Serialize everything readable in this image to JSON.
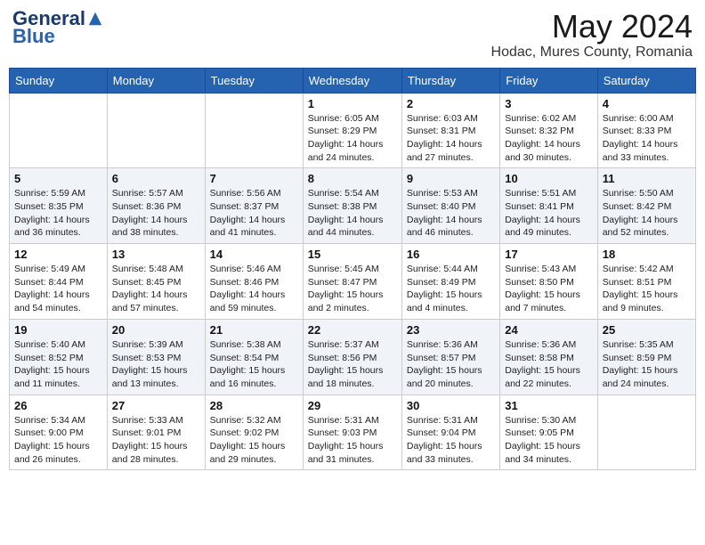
{
  "logo": {
    "general": "General",
    "blue": "Blue"
  },
  "header": {
    "month_year": "May 2024",
    "location": "Hodac, Mures County, Romania"
  },
  "days_of_week": [
    "Sunday",
    "Monday",
    "Tuesday",
    "Wednesday",
    "Thursday",
    "Friday",
    "Saturday"
  ],
  "weeks": [
    [
      {
        "day": "",
        "info": ""
      },
      {
        "day": "",
        "info": ""
      },
      {
        "day": "",
        "info": ""
      },
      {
        "day": "1",
        "info": "Sunrise: 6:05 AM\nSunset: 8:29 PM\nDaylight: 14 hours and 24 minutes."
      },
      {
        "day": "2",
        "info": "Sunrise: 6:03 AM\nSunset: 8:31 PM\nDaylight: 14 hours and 27 minutes."
      },
      {
        "day": "3",
        "info": "Sunrise: 6:02 AM\nSunset: 8:32 PM\nDaylight: 14 hours and 30 minutes."
      },
      {
        "day": "4",
        "info": "Sunrise: 6:00 AM\nSunset: 8:33 PM\nDaylight: 14 hours and 33 minutes."
      }
    ],
    [
      {
        "day": "5",
        "info": "Sunrise: 5:59 AM\nSunset: 8:35 PM\nDaylight: 14 hours and 36 minutes."
      },
      {
        "day": "6",
        "info": "Sunrise: 5:57 AM\nSunset: 8:36 PM\nDaylight: 14 hours and 38 minutes."
      },
      {
        "day": "7",
        "info": "Sunrise: 5:56 AM\nSunset: 8:37 PM\nDaylight: 14 hours and 41 minutes."
      },
      {
        "day": "8",
        "info": "Sunrise: 5:54 AM\nSunset: 8:38 PM\nDaylight: 14 hours and 44 minutes."
      },
      {
        "day": "9",
        "info": "Sunrise: 5:53 AM\nSunset: 8:40 PM\nDaylight: 14 hours and 46 minutes."
      },
      {
        "day": "10",
        "info": "Sunrise: 5:51 AM\nSunset: 8:41 PM\nDaylight: 14 hours and 49 minutes."
      },
      {
        "day": "11",
        "info": "Sunrise: 5:50 AM\nSunset: 8:42 PM\nDaylight: 14 hours and 52 minutes."
      }
    ],
    [
      {
        "day": "12",
        "info": "Sunrise: 5:49 AM\nSunset: 8:44 PM\nDaylight: 14 hours and 54 minutes."
      },
      {
        "day": "13",
        "info": "Sunrise: 5:48 AM\nSunset: 8:45 PM\nDaylight: 14 hours and 57 minutes."
      },
      {
        "day": "14",
        "info": "Sunrise: 5:46 AM\nSunset: 8:46 PM\nDaylight: 14 hours and 59 minutes."
      },
      {
        "day": "15",
        "info": "Sunrise: 5:45 AM\nSunset: 8:47 PM\nDaylight: 15 hours and 2 minutes."
      },
      {
        "day": "16",
        "info": "Sunrise: 5:44 AM\nSunset: 8:49 PM\nDaylight: 15 hours and 4 minutes."
      },
      {
        "day": "17",
        "info": "Sunrise: 5:43 AM\nSunset: 8:50 PM\nDaylight: 15 hours and 7 minutes."
      },
      {
        "day": "18",
        "info": "Sunrise: 5:42 AM\nSunset: 8:51 PM\nDaylight: 15 hours and 9 minutes."
      }
    ],
    [
      {
        "day": "19",
        "info": "Sunrise: 5:40 AM\nSunset: 8:52 PM\nDaylight: 15 hours and 11 minutes."
      },
      {
        "day": "20",
        "info": "Sunrise: 5:39 AM\nSunset: 8:53 PM\nDaylight: 15 hours and 13 minutes."
      },
      {
        "day": "21",
        "info": "Sunrise: 5:38 AM\nSunset: 8:54 PM\nDaylight: 15 hours and 16 minutes."
      },
      {
        "day": "22",
        "info": "Sunrise: 5:37 AM\nSunset: 8:56 PM\nDaylight: 15 hours and 18 minutes."
      },
      {
        "day": "23",
        "info": "Sunrise: 5:36 AM\nSunset: 8:57 PM\nDaylight: 15 hours and 20 minutes."
      },
      {
        "day": "24",
        "info": "Sunrise: 5:36 AM\nSunset: 8:58 PM\nDaylight: 15 hours and 22 minutes."
      },
      {
        "day": "25",
        "info": "Sunrise: 5:35 AM\nSunset: 8:59 PM\nDaylight: 15 hours and 24 minutes."
      }
    ],
    [
      {
        "day": "26",
        "info": "Sunrise: 5:34 AM\nSunset: 9:00 PM\nDaylight: 15 hours and 26 minutes."
      },
      {
        "day": "27",
        "info": "Sunrise: 5:33 AM\nSunset: 9:01 PM\nDaylight: 15 hours and 28 minutes."
      },
      {
        "day": "28",
        "info": "Sunrise: 5:32 AM\nSunset: 9:02 PM\nDaylight: 15 hours and 29 minutes."
      },
      {
        "day": "29",
        "info": "Sunrise: 5:31 AM\nSunset: 9:03 PM\nDaylight: 15 hours and 31 minutes."
      },
      {
        "day": "30",
        "info": "Sunrise: 5:31 AM\nSunset: 9:04 PM\nDaylight: 15 hours and 33 minutes."
      },
      {
        "day": "31",
        "info": "Sunrise: 5:30 AM\nSunset: 9:05 PM\nDaylight: 15 hours and 34 minutes."
      },
      {
        "day": "",
        "info": ""
      }
    ]
  ]
}
